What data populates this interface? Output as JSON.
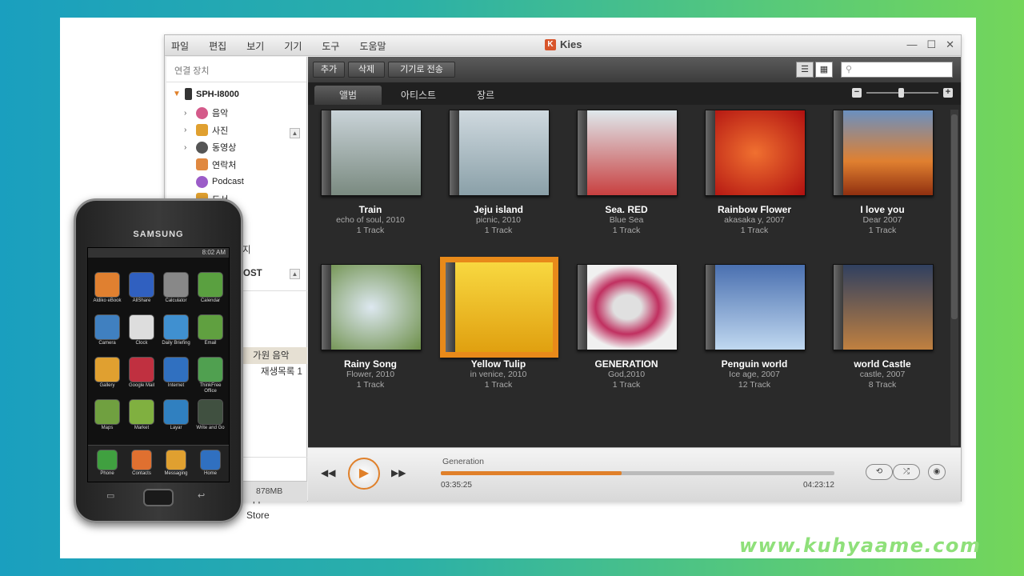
{
  "window": {
    "title": "Kies",
    "menu": [
      "파일",
      "편집",
      "보기",
      "기기",
      "도구",
      "도움말"
    ]
  },
  "left_pane": {
    "header": "연결 장치",
    "device": "SPH-I8000",
    "items": [
      {
        "label": "음악",
        "color": "#d45a8a"
      },
      {
        "label": "사진",
        "color": "#e0a030"
      },
      {
        "label": "동영상",
        "color": "#555555"
      },
      {
        "label": "연락처",
        "color": "#e08840"
      },
      {
        "label": "Podcast",
        "color": "#9b5cc8"
      },
      {
        "label": "도서",
        "color": "#e0a030"
      }
    ],
    "partial_1": "지",
    "partial_2": "OST",
    "selected": "가원 음악",
    "playlist": "재생목록 1",
    "apps": "Apps",
    "store": "Store",
    "storage": "878MB"
  },
  "toolbar": {
    "add": "추가",
    "delete": "삭제",
    "transfer": "기기로 전송"
  },
  "tabs": [
    "앨범",
    "아티스트",
    "장르"
  ],
  "albums": [
    {
      "title": "Train",
      "sub": "echo of soul, 2010",
      "tracks": "1 Track",
      "bg": "linear-gradient(#c9d3d8,#7a8a80)"
    },
    {
      "title": "Jeju island",
      "sub": "picnic, 2010",
      "tracks": "1 Track",
      "bg": "linear-gradient(#cfd9df,#8aa0a8)"
    },
    {
      "title": "Sea. RED",
      "sub": "Blue Sea",
      "tracks": "1 Track",
      "bg": "linear-gradient(#dfe8ec,#c84040)"
    },
    {
      "title": "Rainbow Flower",
      "sub": "akasaka y, 2007",
      "tracks": "1 Track",
      "bg": "radial-gradient(#f07030,#b01010)"
    },
    {
      "title": "I love you",
      "sub": "Dear 2007",
      "tracks": "1 Track",
      "bg": "linear-gradient(#6a90c0,#e08030 60%,#903010)"
    },
    {
      "title": "Rainy Song",
      "sub": "Flower, 2010",
      "tracks": "1 Track",
      "bg": "radial-gradient(#dde8f0,#6c8e48)"
    },
    {
      "title": "Yellow Tulip",
      "sub": "in venice, 2010",
      "tracks": "1 Track",
      "bg": "linear-gradient(#f8d840,#e0a010)"
    },
    {
      "title": "GENERATION",
      "sub": "God,2010",
      "tracks": "1 Track",
      "bg": "radial-gradient(#e0e0e0 20%,#c03060 45%,#f0f0f0 70%)"
    },
    {
      "title": "Penguin world",
      "sub": "Ice age, 2007",
      "tracks": "12 Track",
      "bg": "linear-gradient(#4a70b0,#c0d8f0)"
    },
    {
      "title": "world Castle",
      "sub": "castle, 2007",
      "tracks": "8 Track",
      "bg": "linear-gradient(#304060,#c08040)"
    }
  ],
  "player": {
    "now_playing": "Generation",
    "elapsed": "03:35:25",
    "total": "04:23:12",
    "progress": 0.46
  },
  "phone": {
    "brand": "SAMSUNG",
    "time": "8:02 AM",
    "apps": [
      {
        "label": "Aldiko eBook",
        "color": "#e08030"
      },
      {
        "label": "AllShare",
        "color": "#3060c0"
      },
      {
        "label": "Calculator",
        "color": "#888888"
      },
      {
        "label": "Calendar",
        "color": "#5aa040"
      },
      {
        "label": "Camera",
        "color": "#4080c0"
      },
      {
        "label": "Clock",
        "color": "#dddddd"
      },
      {
        "label": "Daily Briefing",
        "color": "#4090d0"
      },
      {
        "label": "Email",
        "color": "#60a040"
      },
      {
        "label": "Gallery",
        "color": "#e0a030"
      },
      {
        "label": "Google Mail",
        "color": "#c03040"
      },
      {
        "label": "Internet",
        "color": "#3070c0"
      },
      {
        "label": "ThinkFree Office",
        "color": "#50a050"
      },
      {
        "label": "Maps",
        "color": "#70a040"
      },
      {
        "label": "Market",
        "color": "#80b040"
      },
      {
        "label": "Layar",
        "color": "#3080c0"
      },
      {
        "label": "Write and Go",
        "color": "#405040"
      }
    ],
    "dock": [
      {
        "label": "Phone",
        "color": "#40a040"
      },
      {
        "label": "Contacts",
        "color": "#e07030"
      },
      {
        "label": "Messaging",
        "color": "#e0a030"
      },
      {
        "label": "Home",
        "color": "#3070c0"
      }
    ]
  },
  "watermark": "www.kuhyaame.com"
}
